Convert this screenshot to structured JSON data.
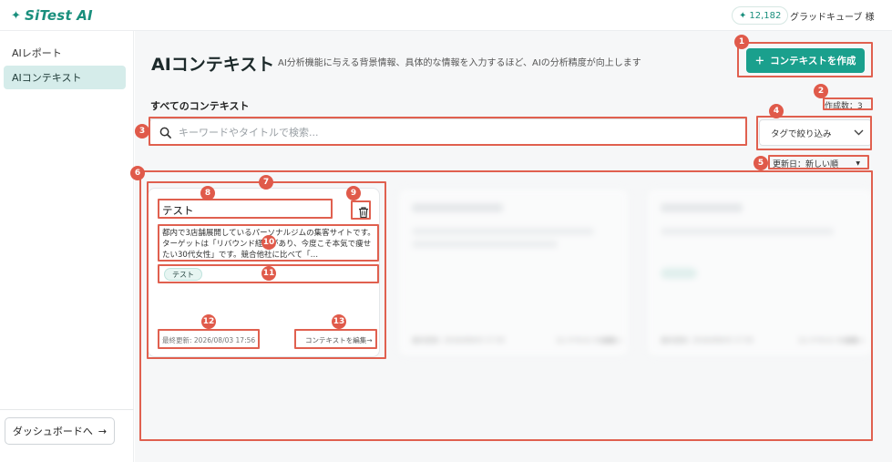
{
  "header": {
    "logo_text": "SiTest AI",
    "credit_amount": "12,182",
    "user_name": "グラッドキューブ 様"
  },
  "sidebar": {
    "items": [
      {
        "label": "AIレポート",
        "active": false
      },
      {
        "label": "AIコンテキスト",
        "active": true
      }
    ],
    "dashboard_button": "ダッシュボードへ"
  },
  "main": {
    "page_title": "AIコンテキスト",
    "page_desc": "AI分析機能に与える背景情報、具体的な情報を入力するほど、AIの分析精度が向上します",
    "create_button": "コンテキストを作成",
    "section_title": "すべてのコンテキスト",
    "count_label": "作成数：3",
    "search_placeholder": "キーワードやタイトルで検索...",
    "tag_filter_label": "タグで絞り込み",
    "sort_label": "更新日：新しい順"
  },
  "cards": [
    {
      "title": "テスト",
      "body": "都内で3店舗展開しているパーソナルジムの集客サイトです。ターゲットは「リバウンド経験があり、今度こそ本気で痩せたい30代女性」です。競合他社に比べて「…",
      "tag": "テスト",
      "date": "最終更新: 2026/08/03 17:56",
      "edit_link": "コンテキストを編集→"
    },
    {
      "title": "",
      "body": "",
      "tag": "",
      "date": "最終更新: 2026/08/03 17:55",
      "edit_link": "コンテキストを編集→"
    },
    {
      "title": "",
      "body": "",
      "tag": "",
      "date": "最終更新: 2026/08/03 17:55",
      "edit_link": "コンテキストを編集→"
    }
  ],
  "annotations": [
    "1",
    "2",
    "3",
    "4",
    "5",
    "6",
    "7",
    "8",
    "9",
    "10",
    "11",
    "12",
    "13"
  ],
  "colors": {
    "accent": "#1aa08d",
    "annotation": "#e05a4a"
  }
}
